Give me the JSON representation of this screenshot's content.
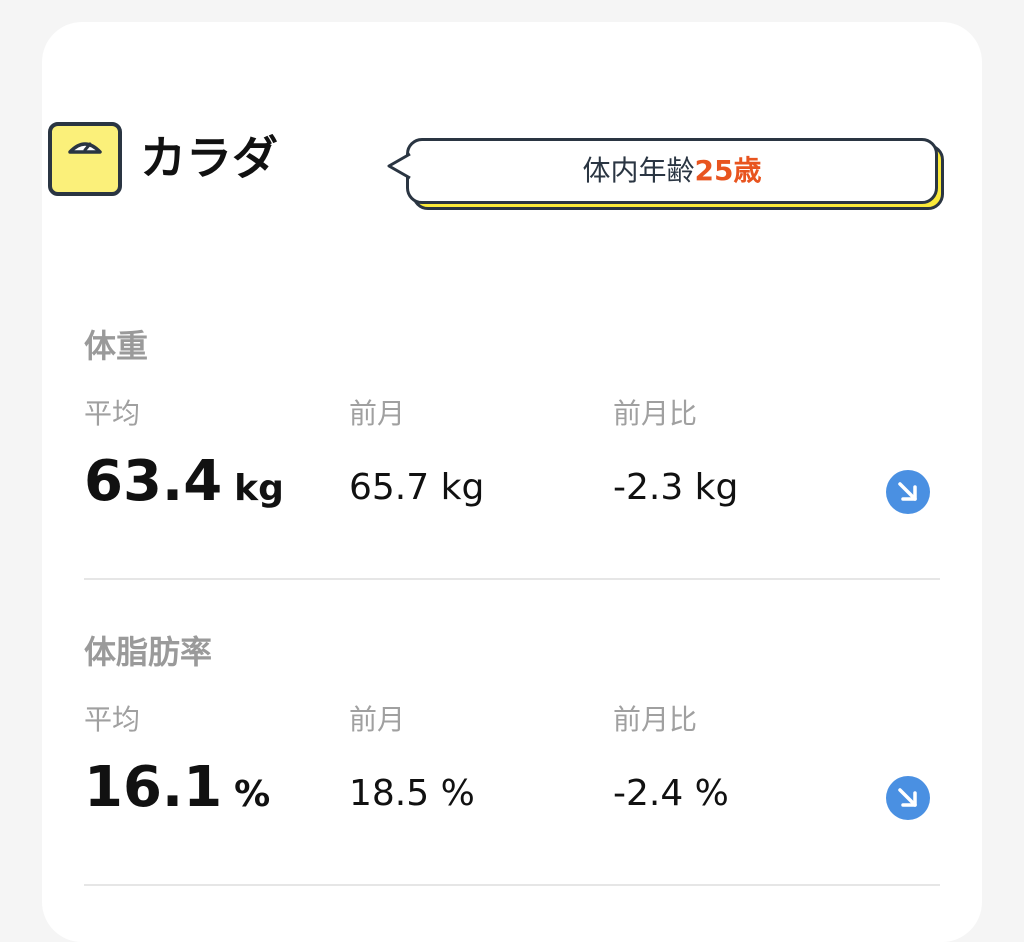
{
  "header": {
    "title": "カラダ",
    "icon": "scale-icon",
    "bubble_prefix": "体内年齢",
    "bubble_age": "25歳"
  },
  "colors": {
    "accent_orange": "#e8541f",
    "icon_yellow": "#fbf07a",
    "trend_blue": "#4a90e2"
  },
  "sections": [
    {
      "title": "体重",
      "labels": {
        "average": "平均",
        "last_month": "前月",
        "change": "前月比"
      },
      "average_value": "63.4",
      "average_unit": "kg",
      "last_month_value": "65.7 kg",
      "change_value": "-2.3 kg",
      "trend_icon": "arrow-down-right-icon"
    },
    {
      "title": "体脂肪率",
      "labels": {
        "average": "平均",
        "last_month": "前月",
        "change": "前月比"
      },
      "average_value": "16.1",
      "average_unit": "%",
      "last_month_value": "18.5 %",
      "change_value": "-2.4 %",
      "trend_icon": "arrow-down-right-icon"
    }
  ]
}
